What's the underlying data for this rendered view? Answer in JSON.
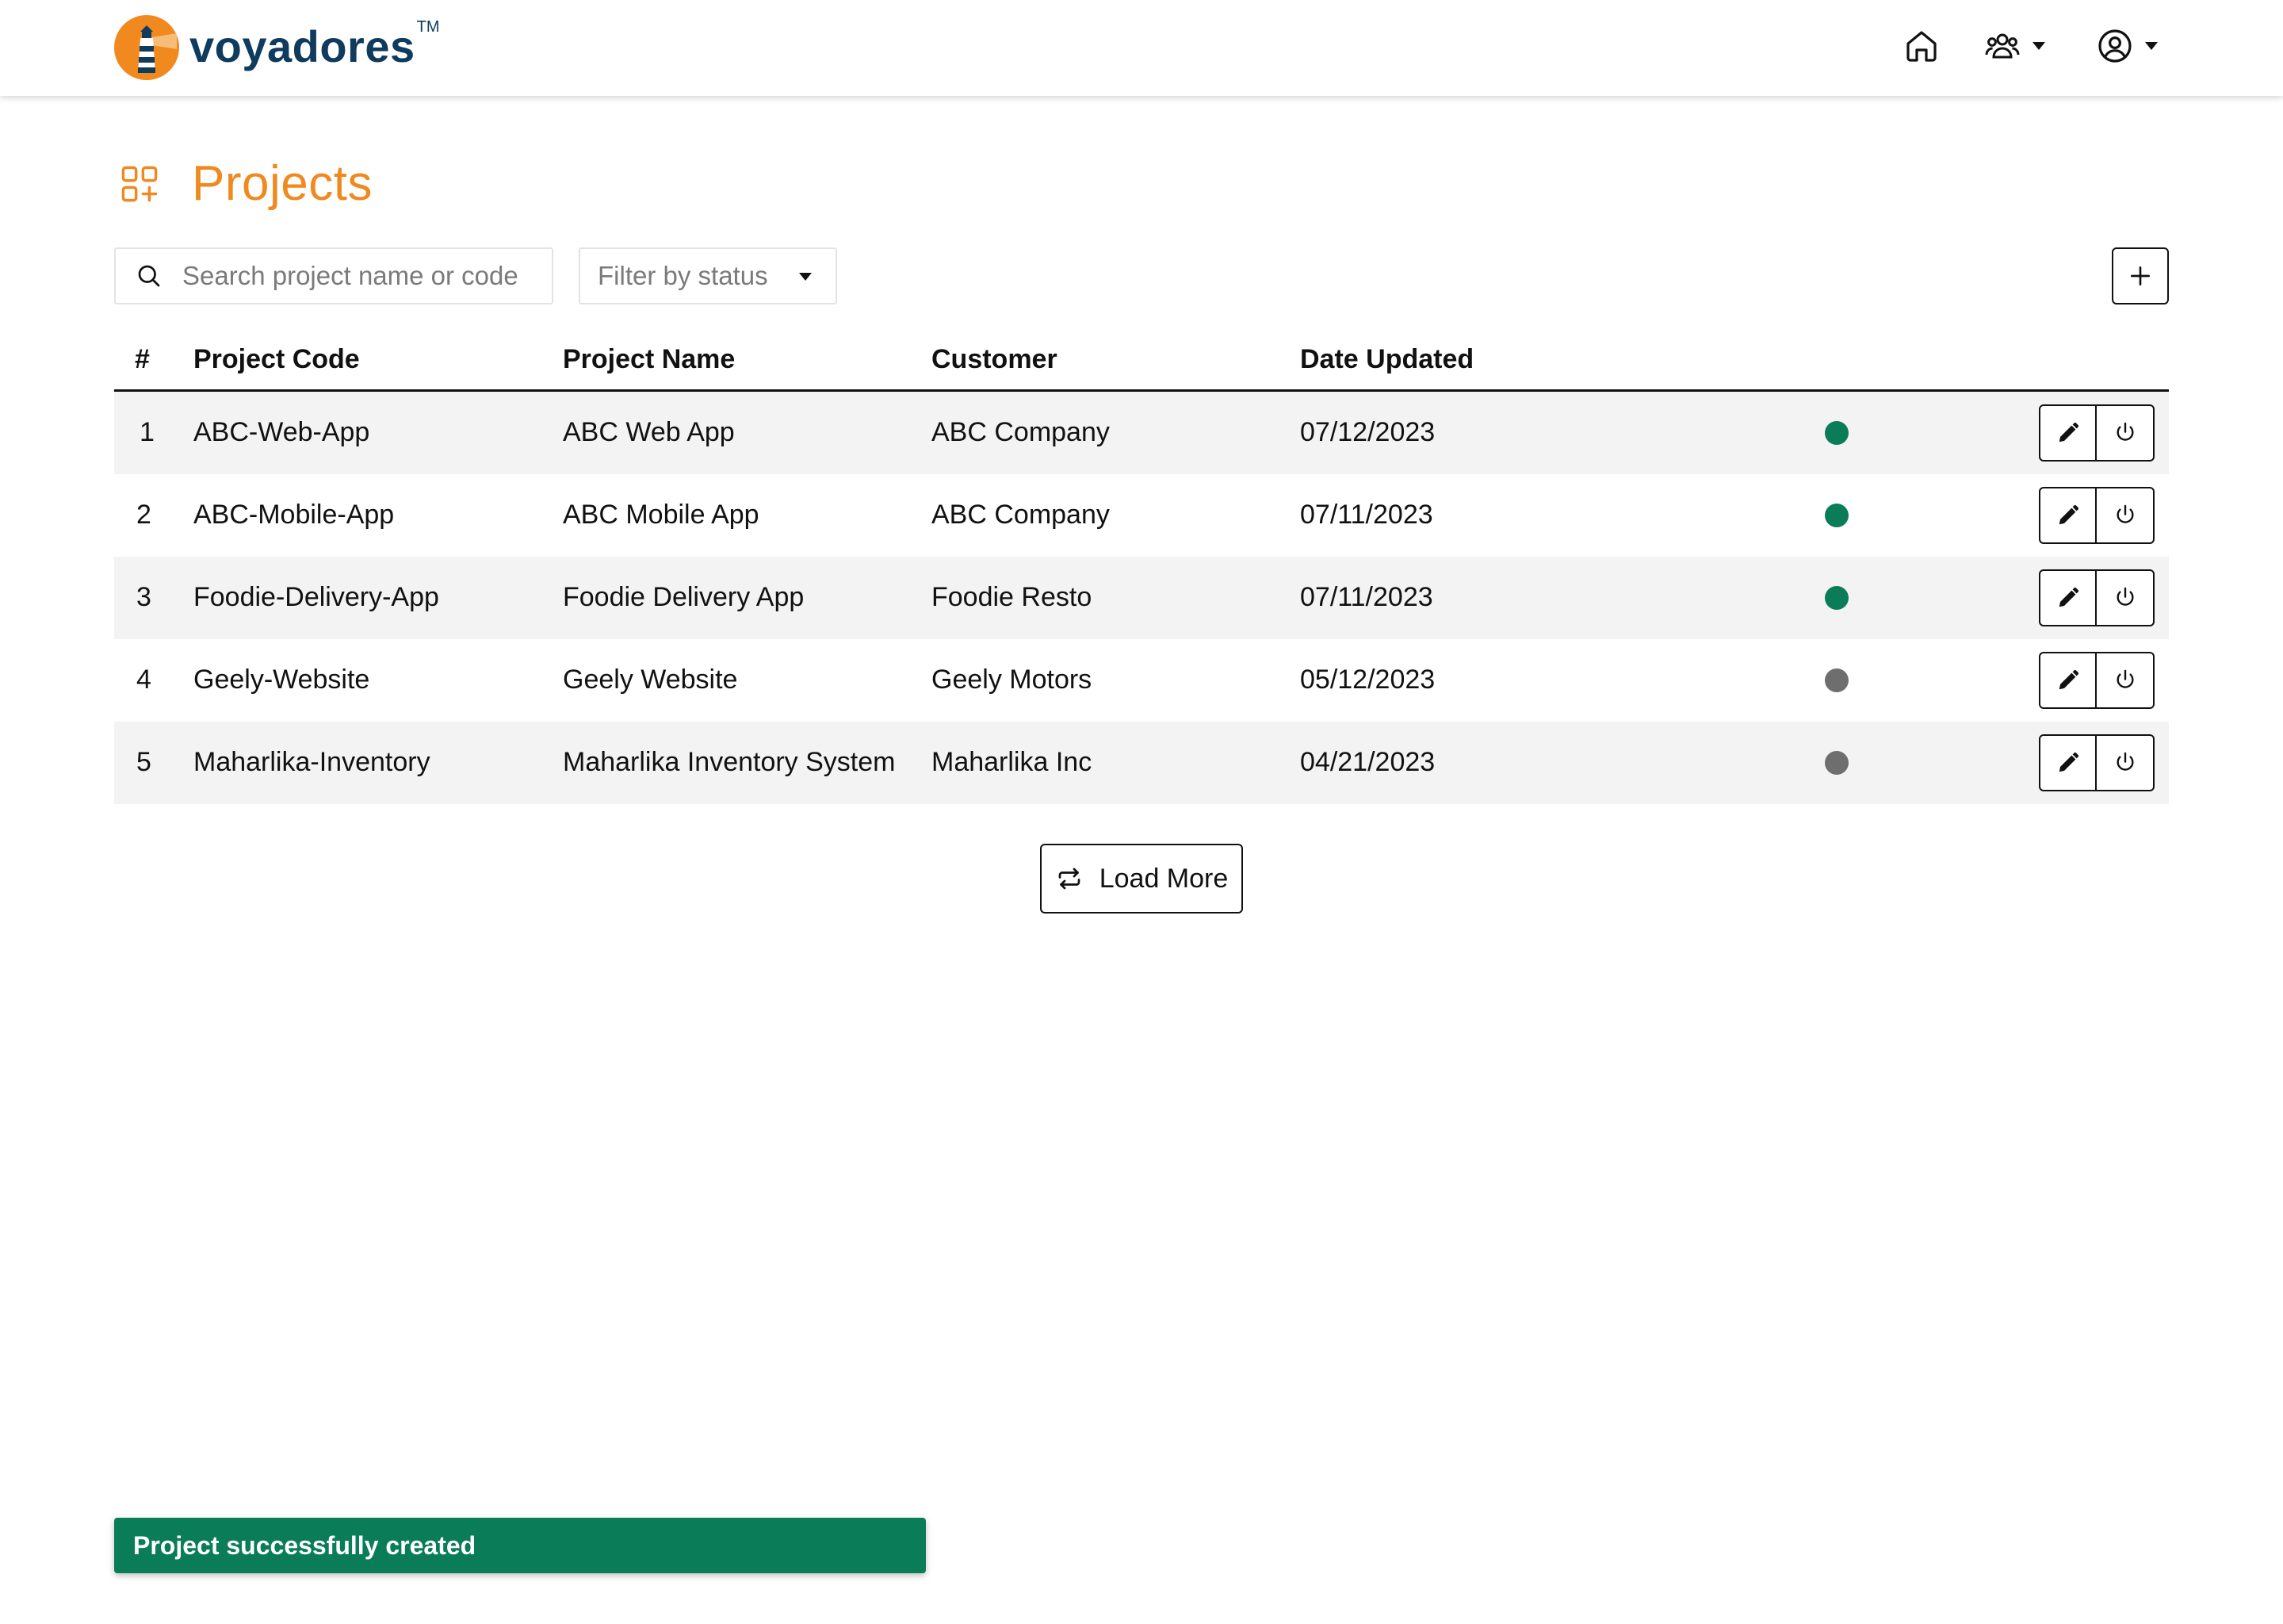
{
  "app": {
    "brand_name": "voyadores",
    "brand_tm": "TM",
    "accent_color": "#f0891e",
    "brand_color": "#0e3b5e"
  },
  "nav": {
    "icons": [
      "home-icon",
      "team-icon",
      "user-circle-icon"
    ]
  },
  "page": {
    "title": "Projects",
    "title_icon": "apps-add-icon"
  },
  "toolbar": {
    "search_placeholder": "Search project name or code",
    "filter_placeholder": "Filter by status",
    "add_icon": "plus-icon"
  },
  "table": {
    "headers": {
      "num": "#",
      "code": "Project Code",
      "name": "Project Name",
      "customer": "Customer",
      "date": "Date Updated"
    },
    "status_colors": {
      "active": "#0a7d58",
      "inactive": "#6e6e6e"
    },
    "rows": [
      {
        "num": "1",
        "code": "ABC-Web-App",
        "name": "ABC Web App",
        "customer": "ABC Company",
        "date": "07/12/2023",
        "status": "active"
      },
      {
        "num": "2",
        "code": "ABC-Mobile-App",
        "name": "ABC Mobile App",
        "customer": "ABC Company",
        "date": "07/11/2023",
        "status": "active"
      },
      {
        "num": "3",
        "code": "Foodie-Delivery-App",
        "name": "Foodie Delivery App",
        "customer": "Foodie Resto",
        "date": "07/11/2023",
        "status": "active"
      },
      {
        "num": "4",
        "code": "Geely-Website",
        "name": "Geely Website",
        "customer": "Geely Motors",
        "date": "05/12/2023",
        "status": "inactive"
      },
      {
        "num": "5",
        "code": "Maharlika-Inventory",
        "name": "Maharlika Inventory System",
        "customer": "Maharlika Inc",
        "date": "04/21/2023",
        "status": "inactive"
      }
    ]
  },
  "load_more": {
    "label": "Load More"
  },
  "toast": {
    "message": "Project successfully created",
    "color": "#0a7d58"
  }
}
